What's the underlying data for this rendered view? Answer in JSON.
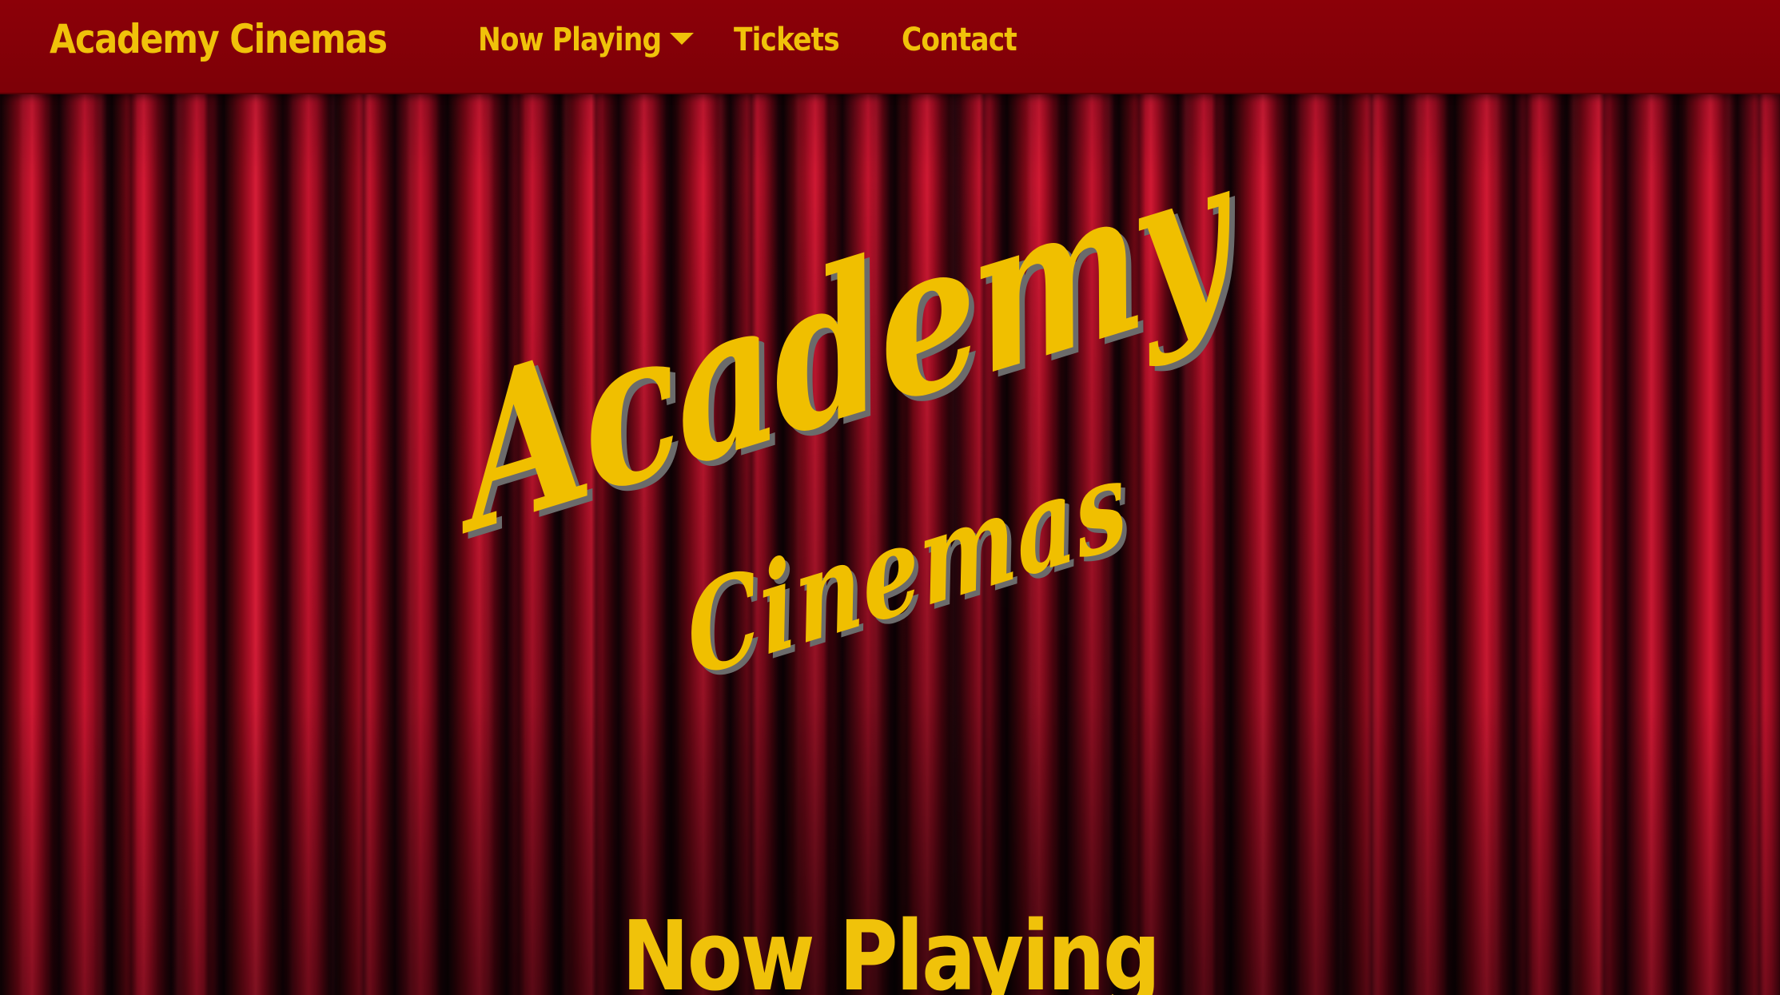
{
  "navbar": {
    "brand": "Academy Cinemas",
    "items": [
      {
        "label": "Now Playing",
        "has_dropdown": true
      },
      {
        "label": "Tickets"
      },
      {
        "label": "Contact"
      }
    ]
  },
  "hero": {
    "logo_line1": "Academy",
    "logo_line2": "Cinemas"
  },
  "main": {
    "section_title": "Now Playing"
  },
  "colors": {
    "navbar_bg": "#8c0008",
    "accent_gold": "#f0c20a",
    "logo_shadow": "#6b6b6b",
    "curtain_red": "#b8112a"
  },
  "icons": {
    "dropdown": "chevron-down-icon"
  }
}
